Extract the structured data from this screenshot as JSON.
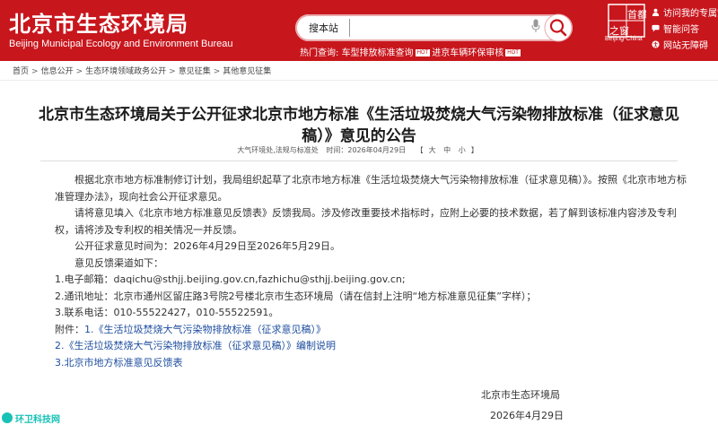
{
  "header": {
    "logo_cn": "北京市生态环境局",
    "logo_en": "Beijing Municipal Ecology and Environment Bureau",
    "search": {
      "label": "搜本站",
      "placeholder": ""
    },
    "hot_prefix": "热门查询:",
    "hot_links": [
      "车型排放标准查询",
      "进京车辆环保审核"
    ],
    "hot_badge": "HOT",
    "emblem_cn": [
      "首都",
      "之窗"
    ],
    "emblem_text": "Beijing-China",
    "right_links": [
      "访问我的专属空间",
      "智能问答",
      "网站无障碍"
    ]
  },
  "breadcrumb": [
    "首页",
    "信息公开",
    "生态环境领域政务公开",
    "意见征集",
    "其他意见征集"
  ],
  "breadcrumb_sep": ">",
  "article": {
    "title": "北京市生态环境局关于公开征求北京市地方标准《生活垃圾焚烧大气污染物排放标准（征求意见稿）》意见的公告",
    "meta": {
      "category": "大气环境处,法规与标准处",
      "date_label": "时间：2026年04月29日",
      "font_prefix": "【",
      "font_sizes": [
        "大",
        "中",
        "小"
      ],
      "font_suffix": "】"
    },
    "paragraphs": [
      "根据北京市地方标准制修订计划，我局组织起草了北京市地方标准《生活垃圾焚烧大气污染物排放标准（征求意见稿）》。按照《北京市地方标准管理办法》，现向社会公开征求意见。",
      "请将意见填入《北京市地方标准意见反馈表》反馈我局。涉及修改重要技术指标时，应附上必要的技术数据，若了解到该标准内容涉及专利权，请将涉及专利权的相关情况一并反馈。",
      "公开征求意见时间为：2026年4月29日至2026年5月29日。",
      "意见反馈渠道如下：",
      "1.电子邮箱：daqichu@sthjj.beijing.gov.cn,fazhichu@sthjj.beijing.gov.cn;",
      "2.通讯地址：北京市通州区留庄路3号院2号楼北京市生态环境局（请在信封上注明“地方标准意见征集”字样）；",
      "3.联系电话：010-55522427，010-55522591。"
    ],
    "attachments_label": "附件：",
    "attachments": [
      "1.《生活垃圾焚烧大气污染物排放标准（征求意见稿）》",
      "2.《生活垃圾焚烧大气污染物排放标准（征求意见稿）》编制说明",
      "3.北京市地方标准意见反馈表"
    ],
    "signature": "北京市生态环境局",
    "sign_date": "2026年4月29日"
  },
  "watermark": "环卫科技网",
  "colors": {
    "brand_red": "#c8161d",
    "link_blue": "#1e4e9f",
    "watermark": "#17c1b6"
  }
}
